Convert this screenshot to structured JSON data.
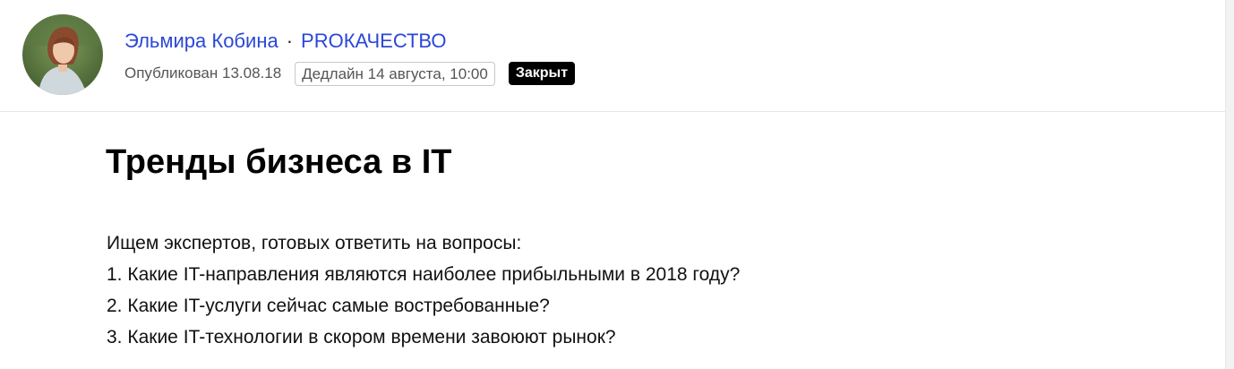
{
  "header": {
    "author_name": "Эльмира Кобина",
    "separator": "·",
    "publication": "PROКАЧЕСТВО",
    "published": "Опубликован 13.08.18",
    "deadline": "Дедлайн 14 августа, 10:00",
    "status": "Закрыт"
  },
  "post": {
    "title": "Тренды бизнеса в IT",
    "lines": [
      "Ищем экспертов, готовых ответить на вопросы:",
      "1. Какие IT-направления являются наиболее прибыльными в 2018 году?",
      "2. Какие IT-услуги сейчас самые востребованные?",
      "3. Какие IT-технологии в скором времени завоюют рынок?"
    ]
  },
  "colors": {
    "link": "#2b47d8",
    "badge_bg": "#000000",
    "badge_text": "#ffffff"
  }
}
